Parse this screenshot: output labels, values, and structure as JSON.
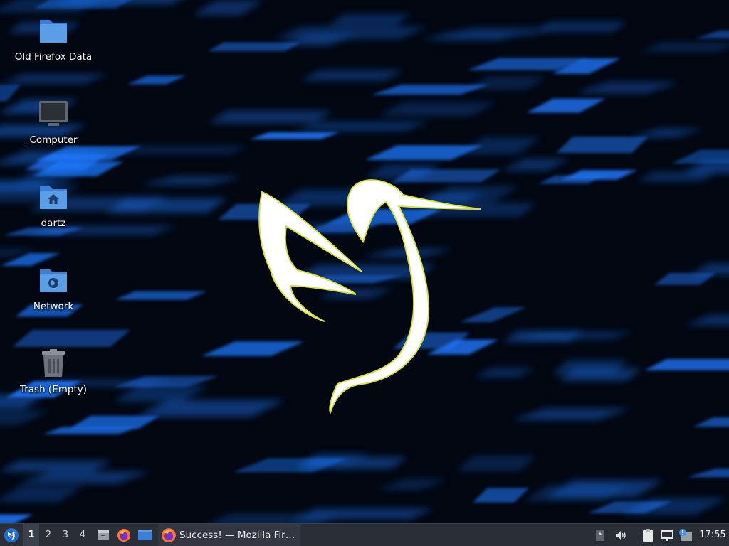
{
  "desktop": {
    "icons": [
      {
        "label": "Old Firefox Data",
        "icon": "folder-icon"
      },
      {
        "label": "Computer",
        "icon": "computer-icon"
      },
      {
        "label": "dartz",
        "icon": "home-folder-icon"
      },
      {
        "label": "Network",
        "icon": "network-folder-icon"
      },
      {
        "label": "Trash (Empty)",
        "icon": "trash-icon"
      }
    ]
  },
  "taskbar": {
    "workspaces": [
      "1",
      "2",
      "3",
      "4"
    ],
    "active_workspace": "1",
    "task": {
      "title": "Success! — Mozilla Fir…",
      "icon": "firefox-icon"
    },
    "clock": "17:55"
  },
  "colors": {
    "wallpaper": "#020712",
    "wallpaper_accent": "#1e78ff",
    "logo": "#ffffff",
    "logo_outline": "#d8e040",
    "taskbar": "#2a2e36",
    "folder": "#4a90e2"
  }
}
